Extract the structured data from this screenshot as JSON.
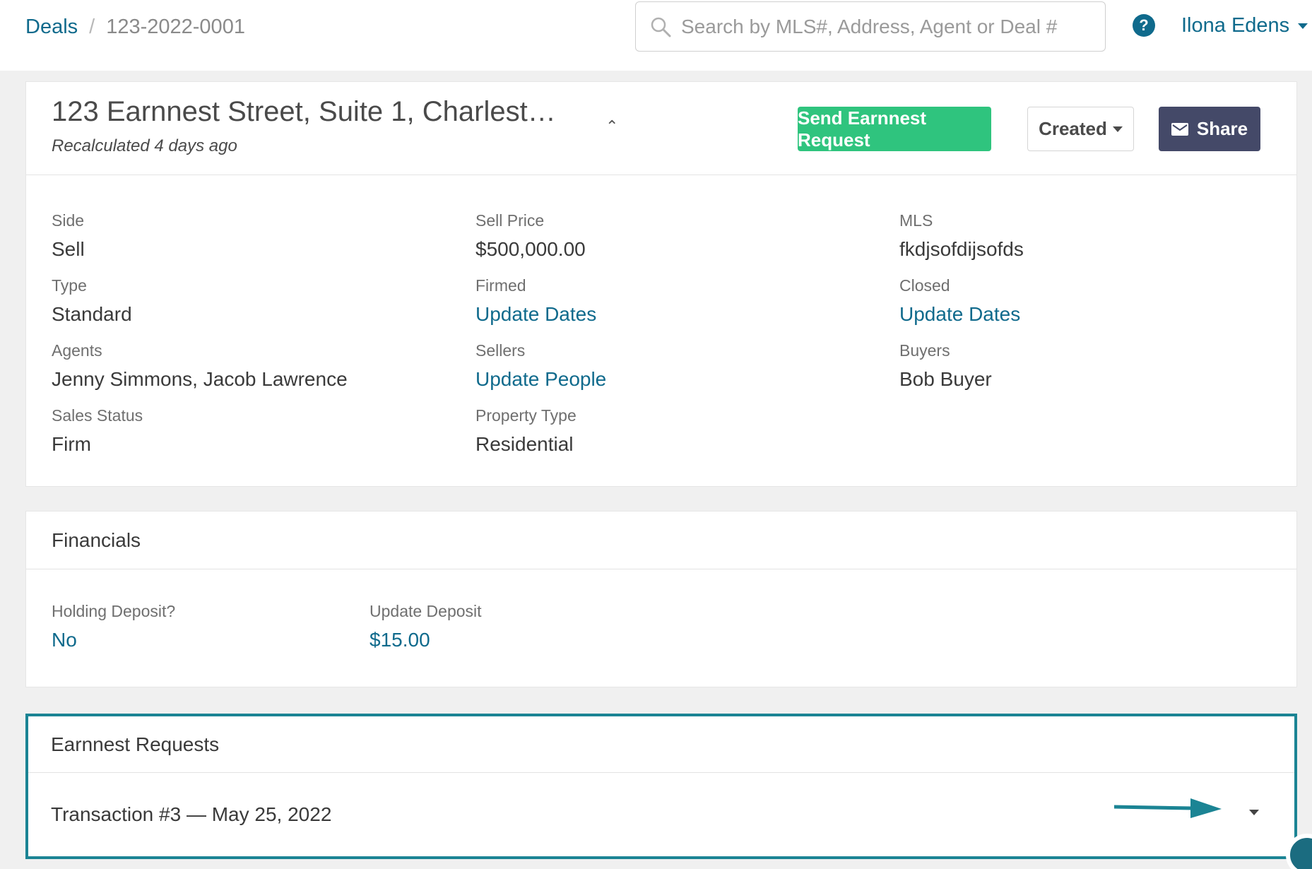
{
  "breadcrumb": {
    "root": "Deals",
    "separator": "/",
    "current": "123-2022-0001"
  },
  "search": {
    "placeholder": "Search by MLS#, Address, Agent or Deal #"
  },
  "header": {
    "help_glyph": "?",
    "user_name": "Ilona Edens"
  },
  "deal": {
    "title": "123 Earnnest Street, Suite 1, Charlest…",
    "subtitle": "Recalculated 4 days ago",
    "collapse_glyph": "⌃",
    "actions": {
      "send_request": "Send Earnnest Request",
      "status": "Created",
      "share": "Share"
    },
    "fields": {
      "col1": [
        {
          "label": "Side",
          "value": "Sell"
        },
        {
          "label": "Type",
          "value": "Standard"
        },
        {
          "label": "Agents",
          "value": "Jenny Simmons, Jacob Lawrence"
        },
        {
          "label": "Sales Status",
          "value": "Firm"
        }
      ],
      "col2": [
        {
          "label": "Sell Price",
          "value": "$500,000.00"
        },
        {
          "label": "Firmed",
          "value": "Update Dates"
        },
        {
          "label": "Sellers",
          "value": "Update People"
        },
        {
          "label": "Property Type",
          "value": "Residential"
        }
      ],
      "col3": [
        {
          "label": "MLS",
          "value": "fkdjsofdijsofds"
        },
        {
          "label": "Closed",
          "value": "Update Dates"
        },
        {
          "label": "Buyers",
          "value": "Bob Buyer"
        }
      ]
    }
  },
  "financials": {
    "title": "Financials",
    "holding_deposit": {
      "label": "Holding Deposit?",
      "value": "No"
    },
    "update_deposit": {
      "label": "Update Deposit",
      "value": "$15.00"
    }
  },
  "earnnest_requests": {
    "title": "Earnnest Requests",
    "transaction": "Transaction #3 — May 25, 2022"
  },
  "colors": {
    "link": "#0f6a8c",
    "primary_green": "#2fc47e",
    "share_dark": "#444968",
    "highlight_border": "#1b8494"
  }
}
